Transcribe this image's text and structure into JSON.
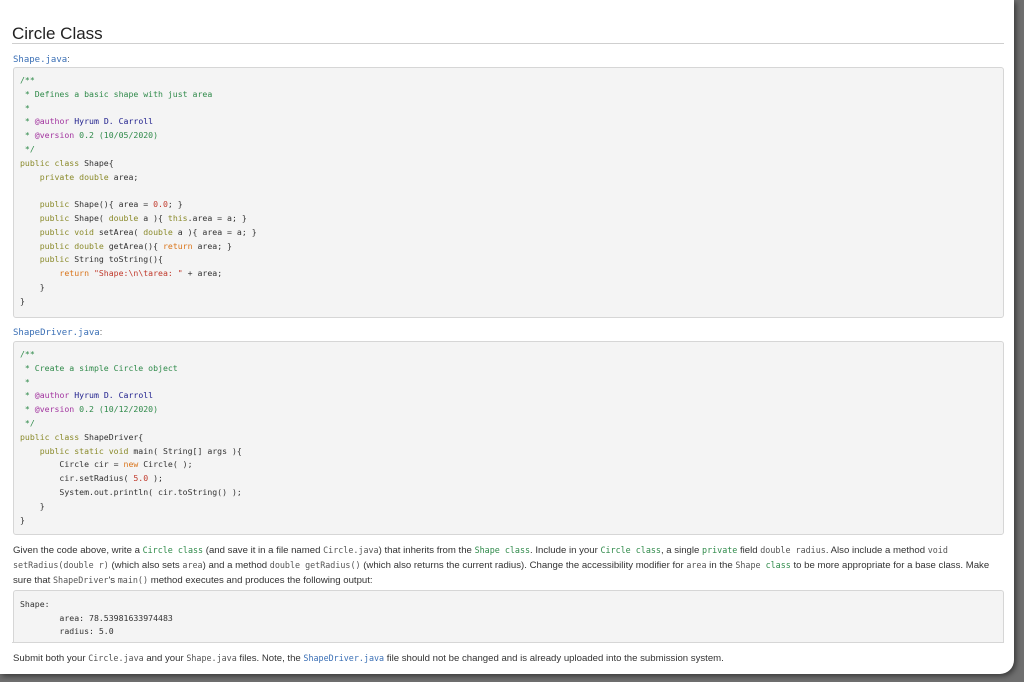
{
  "page": {
    "title": "Circle Class"
  },
  "shape_file": {
    "name": "Shape.java",
    "colon": ":"
  },
  "shape_code": {
    "l1": "/**",
    "l2": " * Defines a basic shape with just area",
    "l3": " *",
    "l4_star": " * ",
    "l4_tag": "@author",
    "l4_val": " Hyrum D. Carroll",
    "l5_star": " * ",
    "l5_tag": "@version",
    "l5_val": " 0.2 (10/05/2020)",
    "l6": " */",
    "l7_kw": "public class",
    "l7_rest": " Shape{",
    "l8_kw": "    private double",
    "l8_rest": " area;",
    "l10_kw": "    public",
    "l10_rest": " Shape(){ area = ",
    "l10_num": "0.0",
    "l10_end": "; }",
    "l11_kw": "    public",
    "l11_mid": " Shape( ",
    "l11_ty": "double",
    "l11_mid2": " a ){ ",
    "l11_kw2": "this",
    "l11_end": ".area = a; }",
    "l12_kw": "    public void",
    "l12_mid": " setArea( ",
    "l12_ty": "double",
    "l12_end": " a ){ area = a; }",
    "l13_kw": "    public double",
    "l13_mid": " getArea(){ ",
    "l13_rt": "return",
    "l13_end": " area; }",
    "l14_kw": "    public",
    "l14_end": " String toString(){",
    "l15_rt": "        return",
    "l15_sp": " ",
    "l15_st": "\"Shape:\\n\\tarea: \"",
    "l15_end": " + area;",
    "l16": "    }",
    "l17": "}"
  },
  "driver_file": {
    "name": "ShapeDriver.java",
    "colon": ":"
  },
  "driver_code": {
    "l1": "/**",
    "l2": " * Create a simple Circle object",
    "l3": " *",
    "l4_star": " * ",
    "l4_tag": "@author",
    "l4_val": " Hyrum D. Carroll",
    "l5_star": " * ",
    "l5_tag": "@version",
    "l5_val": " 0.2 (10/12/2020)",
    "l6": " */",
    "l7_kw": "public class",
    "l7_rest": " ShapeDriver{",
    "l8_kw": "    public static void",
    "l8_rest": " main( String[] args ){",
    "l9_a": "        Circle cir = ",
    "l9_kw": "new",
    "l9_b": " Circle( );",
    "l10_a": "        cir.setRadius( ",
    "l10_num": "5.0",
    "l10_b": " );",
    "l11": "        System.out.println( cir.toString() );",
    "l12": "    }",
    "l13": "}"
  },
  "instructions": {
    "p1_a": "Given the code above, write a ",
    "p1_circle_class": "Circle class",
    "p1_b": " (and save it in a file named ",
    "p1_circle_java": "Circle.java",
    "p1_c": ") that inherits from the ",
    "p1_shape_class": "Shape class",
    "p1_d": ". Include in your ",
    "p1_circle_class2": "Circle class",
    "p1_e": ", a single ",
    "p1_private": "private",
    "p1_f": " field ",
    "p1_field": "double radius",
    "p1_g": ". Also include a method ",
    "p1_setradius": "void setRadius(double r)",
    "p1_h": " (which also sets ",
    "p1_area": "area",
    "p1_i": ") and a method ",
    "p1_getradius": "double getRadius()",
    "p1_j": " (which also returns the current radius). Change the accessibility modifier for ",
    "p1_area2": "area",
    "p1_k": " in the ",
    "p1_shape": "Shape",
    "p1_class": " class",
    "p1_l": " to be more appropriate for a base class. Make sure that ",
    "p1_shapedriver": "ShapeDriver",
    "p1_m": "'s ",
    "p1_main": "main()",
    "p1_n": " method executes and produces the following output:"
  },
  "output": {
    "l1": "Shape:",
    "l2": "        area: 78.53981633974483",
    "l3": "        radius: 5.0"
  },
  "submit": {
    "a": "Submit both your ",
    "circle_java": "Circle.java",
    "b": " and your ",
    "shape_java": "Shape.java",
    "c": " files. Note, the ",
    "driver_java": "ShapeDriver.java",
    "d": " file should not be changed and is already uploaded into the submission system."
  }
}
